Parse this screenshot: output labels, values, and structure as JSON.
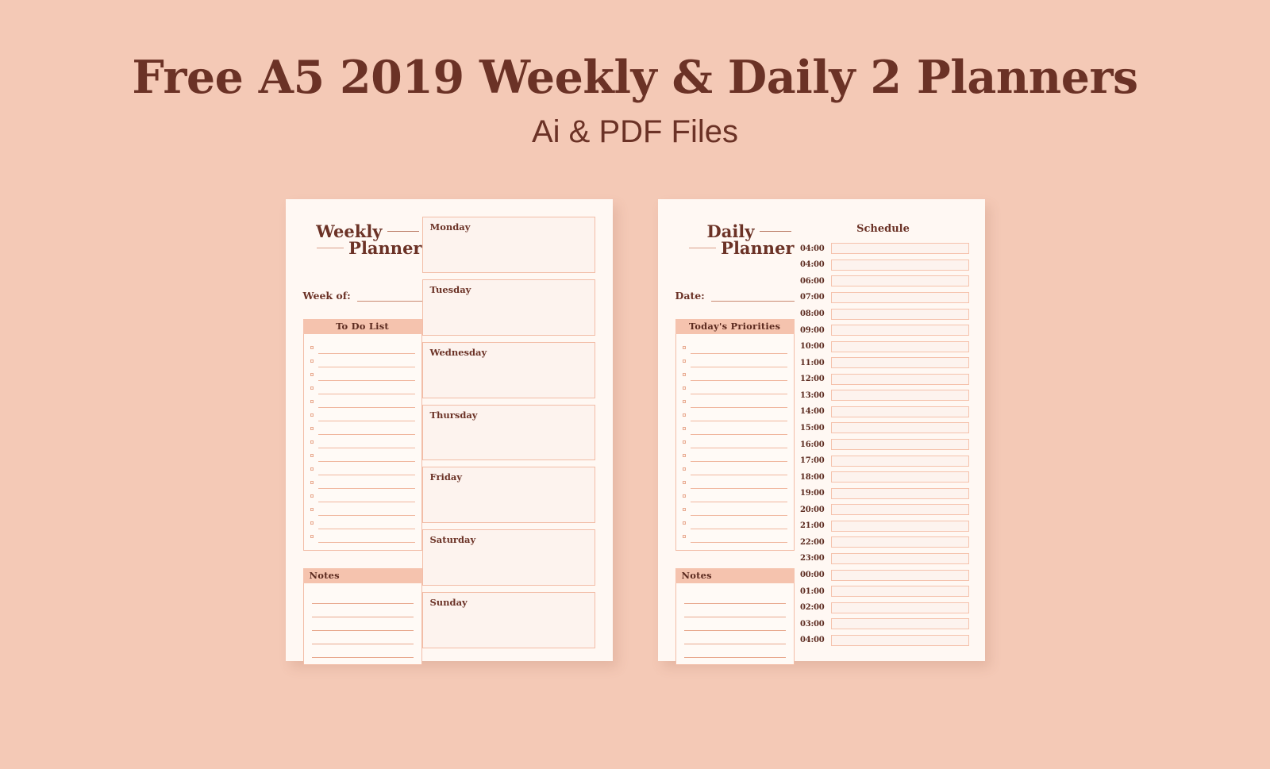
{
  "header": {
    "title": "Free A5 2019 Weekly & Daily 2 Planners",
    "subtitle": "Ai & PDF Files"
  },
  "colors": {
    "background": "#f4c9b6",
    "page": "#fff8f3",
    "accent_bar": "#f5c3ae",
    "ink": "#6b3226",
    "border": "#f2bda7",
    "box_fill": "#fdf3ee"
  },
  "weekly": {
    "brand_line1": "Weekly",
    "brand_line2": "Planner",
    "week_of_label": "Week of:",
    "todo": {
      "heading": "To Do List",
      "row_count": 15
    },
    "notes": {
      "heading": "Notes",
      "row_count": 5
    },
    "days": [
      {
        "label": "Monday"
      },
      {
        "label": "Tuesday"
      },
      {
        "label": "Wednesday"
      },
      {
        "label": "Thursday"
      },
      {
        "label": "Friday"
      },
      {
        "label": "Saturday"
      },
      {
        "label": "Sunday"
      }
    ]
  },
  "daily": {
    "brand_line1": "Daily",
    "brand_line2": "Planner",
    "date_label": "Date:",
    "priorities": {
      "heading": "Today's Priorities",
      "row_count": 15
    },
    "notes": {
      "heading": "Notes",
      "row_count": 5
    },
    "schedule": {
      "heading": "Schedule",
      "times": [
        "04:00",
        "04:00",
        "06:00",
        "07:00",
        "08:00",
        "09:00",
        "10:00",
        "11:00",
        "12:00",
        "13:00",
        "14:00",
        "15:00",
        "16:00",
        "17:00",
        "18:00",
        "19:00",
        "20:00",
        "21:00",
        "22:00",
        "23:00",
        "00:00",
        "01:00",
        "02:00",
        "03:00",
        "04:00"
      ]
    }
  }
}
